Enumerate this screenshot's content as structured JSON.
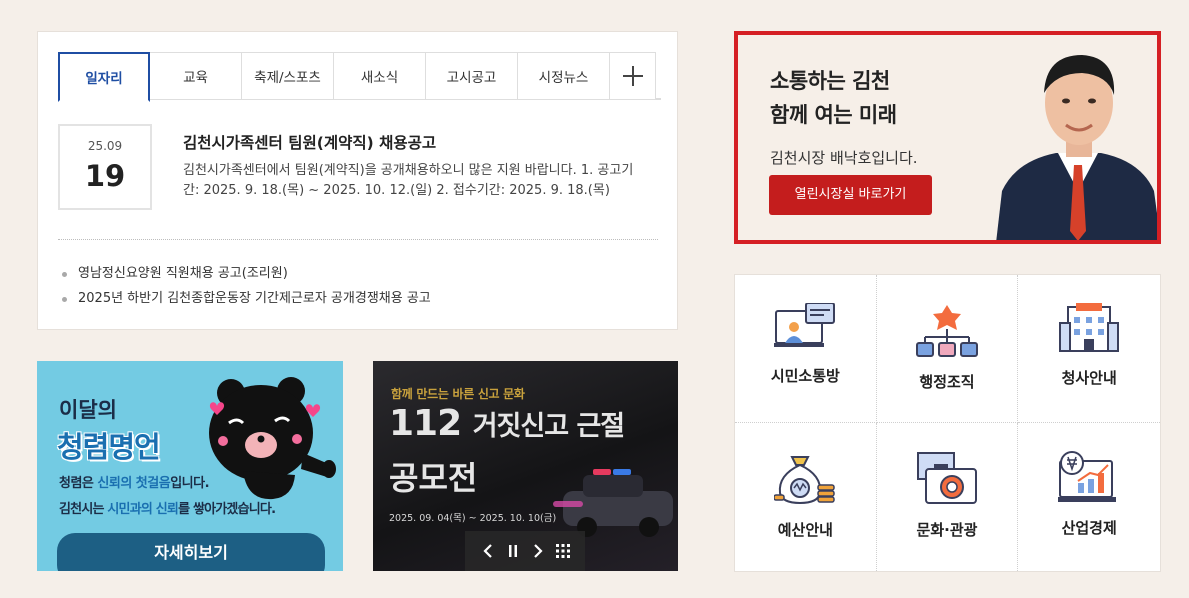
{
  "news": {
    "tabs": [
      "일자리",
      "교육",
      "축제/스포츠",
      "새소식",
      "고시공고",
      "시정뉴스"
    ],
    "more_icon": "plus-icon",
    "featured": {
      "year_month": "25.09",
      "day": "19",
      "title": "김천시가족센터 팀원(계약직) 채용공고",
      "desc": "김천시가족센터에서 팀원(계약직)을 공개채용하오니 많은 지원 바랍니다. 1. 공고기간: 2025. 9. 18.(목) ~ 2025. 10. 12.(일) 2. 접수기간: 2025. 9. 18.(목)"
    },
    "list": [
      "영남정신요양원 직원채용 공고(조리원)",
      "2025년 하반기 김천종합운동장 기간제근로자 공개경쟁채용 공고"
    ]
  },
  "banner1": {
    "sub": "이달의",
    "title": "청렴명언",
    "line1_a": "청렴은 ",
    "line1_b": "신뢰의 첫걸음",
    "line1_c": "입니다.",
    "line2_a": "김천시는 ",
    "line2_b": "시민과의 신뢰",
    "line2_c": "를 쌓아가겠습니다.",
    "button": "자세히보기",
    "colors": {
      "bg": "#73cbe3",
      "accent": "#1a6fb0",
      "button": "#1d5f84"
    }
  },
  "banner2": {
    "eyebrow": "함께 만드는 바른 신고 문화",
    "title_num": "112",
    "title_rest": "거짓신고 근절",
    "title_line2": "공모전",
    "period": "2025. 09. 04(목) ~ 2025. 10. 10(금)",
    "controls": [
      "prev-icon",
      "pause-icon",
      "next-icon",
      "grid-icon"
    ]
  },
  "mayor": {
    "line1": "소통하는 김천",
    "line2": "함께 여는 미래",
    "intro": "김천시장 배낙호입니다.",
    "button": "열린시장실 바로가기",
    "colors": {
      "border": "#d51f24",
      "button": "#c41d1d"
    }
  },
  "quick_menu": [
    {
      "label": "시민소통방",
      "icon": "citizen-communication-icon"
    },
    {
      "label": "행정조직",
      "icon": "org-chart-icon"
    },
    {
      "label": "청사안내",
      "icon": "building-icon"
    },
    {
      "label": "예산안내",
      "icon": "money-bag-icon"
    },
    {
      "label": "문화·관광",
      "icon": "camera-icon"
    },
    {
      "label": "산업경제",
      "icon": "economy-chart-icon"
    }
  ]
}
